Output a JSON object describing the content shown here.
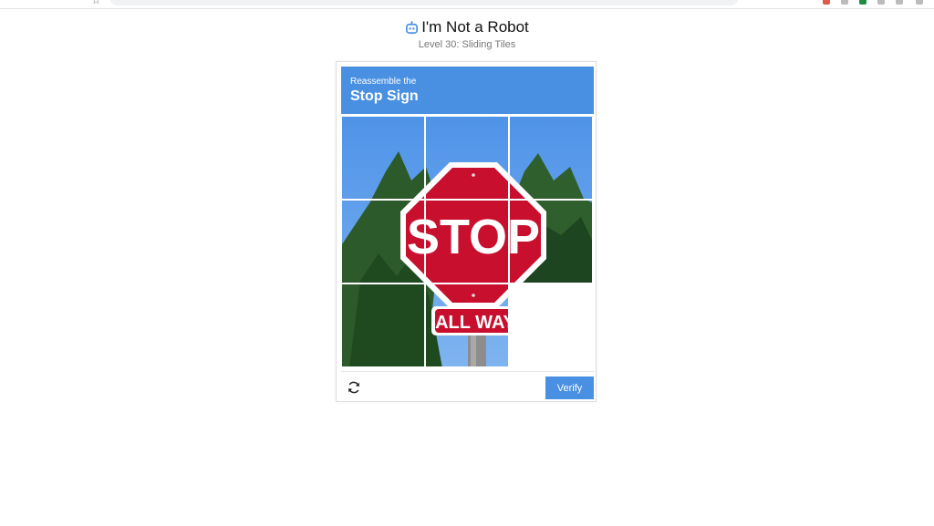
{
  "page": {
    "title": "I'm Not a Robot",
    "subtitle": "Level 30: Sliding Tiles"
  },
  "captcha": {
    "prompt_small": "Reassemble the",
    "prompt_big": "Stop Sign",
    "verify_label": "Verify",
    "refresh_icon": "refresh-icon",
    "accent_color": "#4a90e2",
    "grid_rows": 3,
    "grid_cols": 3,
    "empty_tile": {
      "row": 3,
      "col": 3
    },
    "sign_text": "STOP",
    "subsign_text": "ALL WAY"
  },
  "icons": {
    "title_icon": "robot-icon"
  }
}
